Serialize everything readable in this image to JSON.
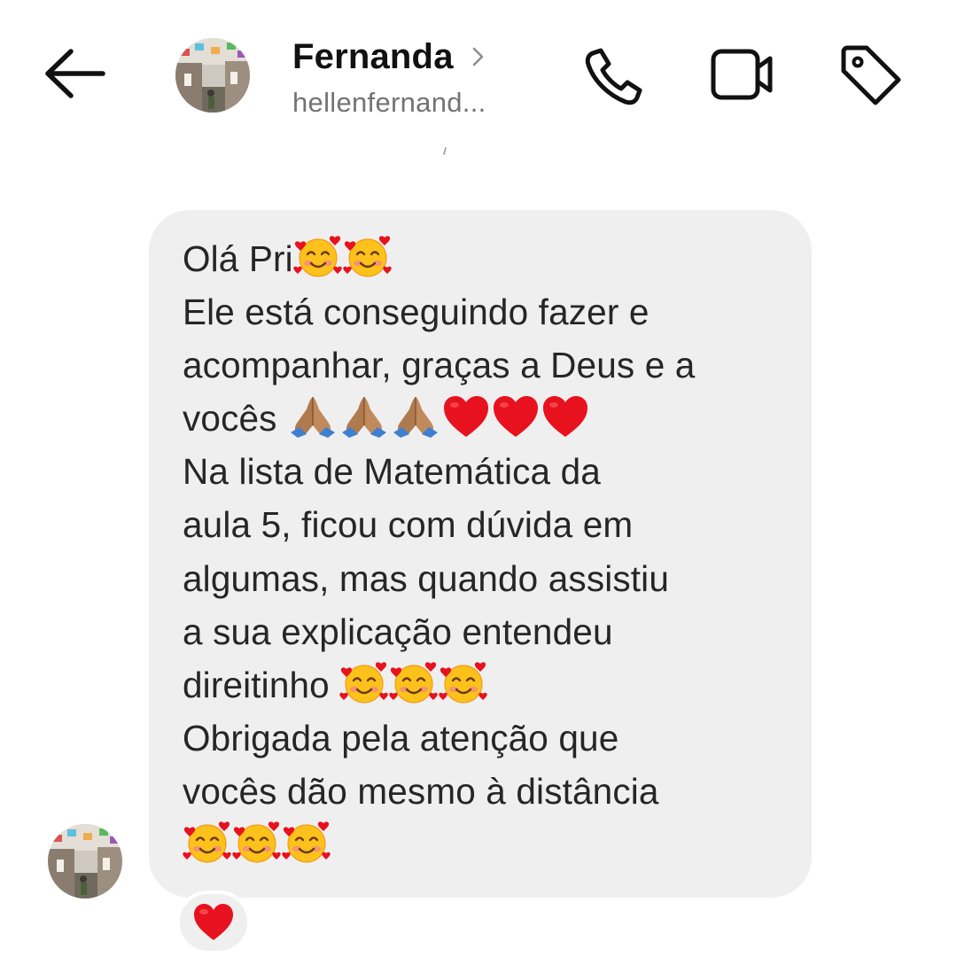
{
  "header": {
    "contact_name": "Fernanda",
    "username": "hellenfernand...",
    "back_icon": "arrow-left-icon",
    "chevron_icon": "chevron-right-icon",
    "call_icon": "phone-icon",
    "video_icon": "video-camera-icon",
    "label_icon": "tag-icon"
  },
  "message": {
    "sender": "Fernanda",
    "lines": [
      {
        "text": "Olá Pri",
        "emoji_after": [
          "smiling-face-with-hearts",
          "smiling-face-with-hearts"
        ]
      },
      {
        "text": "Ele está conseguindo fazer e",
        "emoji_after": []
      },
      {
        "text": "acompanhar, graças a Deus e a",
        "emoji_after": []
      },
      {
        "text": "vocês ",
        "emoji_after": [
          "folded-hands",
          "folded-hands",
          "folded-hands",
          "red-heart",
          "red-heart",
          "red-heart"
        ]
      },
      {
        "text": "Na lista de Matemática da",
        "emoji_after": []
      },
      {
        "text": "aula 5, ficou com dúvida em",
        "emoji_after": []
      },
      {
        "text": "algumas, mas quando assistiu",
        "emoji_after": []
      },
      {
        "text": "a sua explicação entendeu",
        "emoji_after": []
      },
      {
        "text": "direitinho ",
        "emoji_after": [
          "smiling-face-with-hearts",
          "smiling-face-with-hearts",
          "smiling-face-with-hearts"
        ]
      },
      {
        "text": "Obrigada pela atenção que",
        "emoji_after": []
      },
      {
        "text": "vocês dão mesmo à distância",
        "emoji_after": []
      },
      {
        "text": "",
        "emoji_after": [
          "smiling-face-with-hearts",
          "smiling-face-with-hearts",
          "smiling-face-with-hearts"
        ]
      }
    ],
    "reaction": "red-heart"
  },
  "colors": {
    "bubble": "#efefef",
    "text": "#262626",
    "secondary_text": "#737373",
    "heart": "#e8111e"
  }
}
